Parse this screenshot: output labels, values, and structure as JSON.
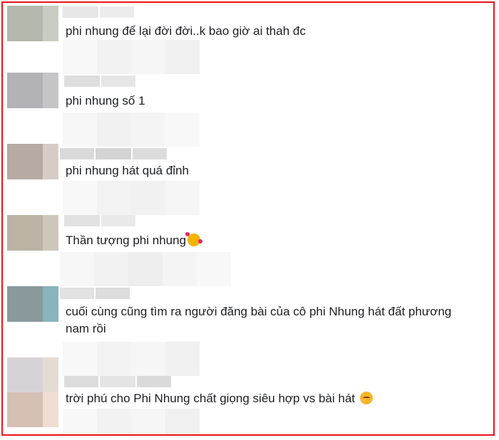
{
  "comments": [
    {
      "text": "phi nhung để lại đời đời..k bao giờ ai thah đc",
      "emoji": ""
    },
    {
      "text": "phi nhung số 1",
      "emoji": ""
    },
    {
      "text": "phi nhung hát quá đỉnh",
      "emoji": ""
    },
    {
      "text": "Thần tượng phi nhung",
      "emoji": "smiling-face-with-hearts"
    },
    {
      "text": "cuối cùng cũng tìm ra người đăng bài của cô phi Nhung hát đất phương nam rồi",
      "emoji": ""
    },
    {
      "text": "trời phú cho Phi Nhung chất giọng siêu hợp vs bài hát",
      "emoji": "relieved-face"
    }
  ],
  "colors": {
    "frame_border": "#e8141b",
    "text": "#1c1e21"
  }
}
